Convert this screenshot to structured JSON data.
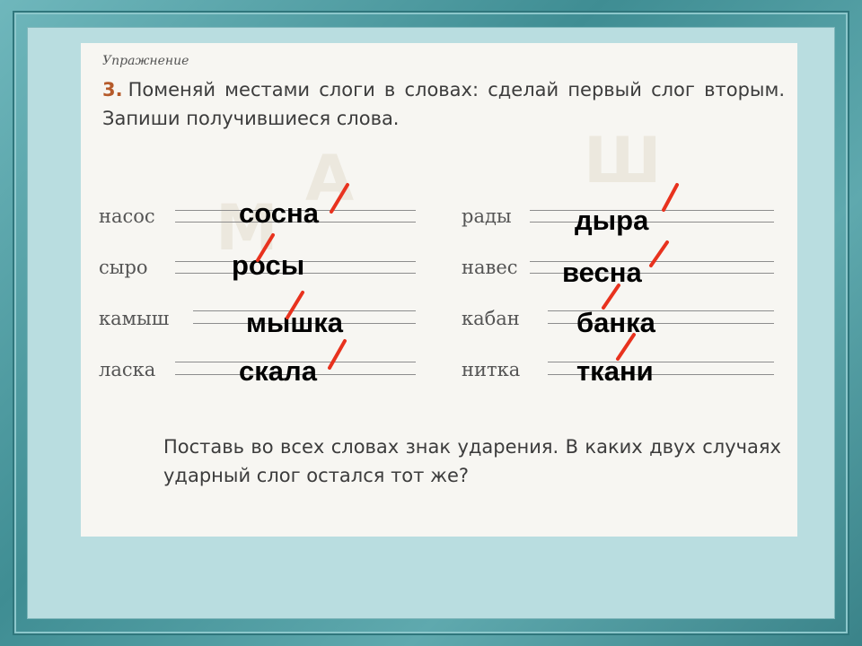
{
  "exercise_label": "Упражнение",
  "task": {
    "number": "3.",
    "text": "Поменяй местами слоги в словах: сделай первый слог вторым. Запиши получившиеся слова."
  },
  "left_column": [
    {
      "word": "насос",
      "answer": "сосна"
    },
    {
      "word": "сыро",
      "answer": "росы"
    },
    {
      "word": "камыш",
      "answer": "мышка"
    },
    {
      "word": "ласка",
      "answer": "скала"
    }
  ],
  "right_column": [
    {
      "word": "рады",
      "answer": "дыра"
    },
    {
      "word": "навес",
      "answer": "весна"
    },
    {
      "word": "кабан",
      "answer": "банка"
    },
    {
      "word": "нитка",
      "answer": "ткани"
    }
  ],
  "footer_text": "Поставь во всех словах знак ударения. В каких двух случаях ударный слог остался тот же?",
  "colors": {
    "frame": "#4e9ea4",
    "slide_bg": "#b9dde0",
    "accent_marks": "#e8321e",
    "task_number": "#b55a2a"
  }
}
